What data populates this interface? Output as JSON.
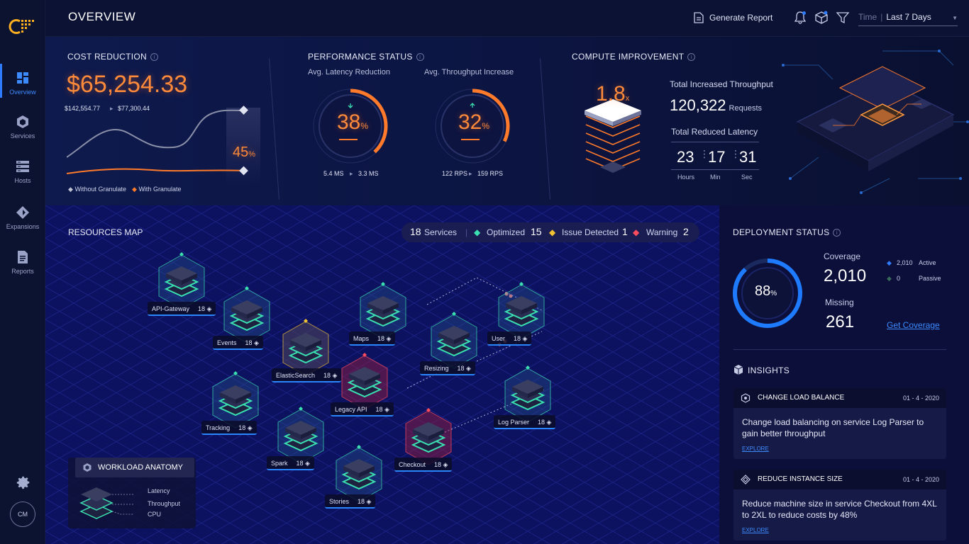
{
  "sidebar": {
    "items": [
      {
        "label": "Overview",
        "icon": "dashboard-icon"
      },
      {
        "label": "Services",
        "icon": "hexagon-icon"
      },
      {
        "label": "Hosts",
        "icon": "server-icon"
      },
      {
        "label": "Expansions",
        "icon": "diamond-icon"
      },
      {
        "label": "Reports",
        "icon": "document-icon"
      }
    ],
    "avatar": "CM"
  },
  "header": {
    "title": "OVERVIEW",
    "report_label": "Generate Report",
    "time_label": "Time",
    "time_value": "Last 7 Days"
  },
  "cost": {
    "title": "COST REDUCTION",
    "value": "$65,254.33",
    "before": "$142,554.77",
    "after": "$77,300.44",
    "percent": "45",
    "percent_unit": "%",
    "legend_without": "Without Granulate",
    "legend_with": "With Granulate"
  },
  "performance": {
    "title": "PERFORMANCE STATUS",
    "latency": {
      "label": "Avg. Latency Reduction",
      "value": "38",
      "unit": "%",
      "from": "5.4 MS",
      "to": "3.3 MS",
      "fraction": 0.38
    },
    "throughput": {
      "label": "Avg. Throughput Increase",
      "value": "32",
      "unit": "%",
      "from": "122 RPS",
      "to": "159 RPS",
      "fraction": 0.32
    }
  },
  "compute": {
    "title": "COMPUTE IMPROVEMENT",
    "multiplier": "1.8",
    "multiplier_unit": "x",
    "throughput_title": "Total Increased Throughput",
    "throughput_value": "120,322",
    "throughput_unit": "Requests",
    "latency_title": "Total Reduced Latency",
    "hours": "23",
    "minutes": "17",
    "seconds": "31",
    "hours_label": "Hours",
    "minutes_label": "Min",
    "seconds_label": "Sec"
  },
  "resources": {
    "title": "RESOURCES MAP",
    "services_count": "18",
    "services_label": "Services",
    "optimized_label": "Optimized",
    "optimized_count": "15",
    "issue_label": "Issue Detected",
    "issue_count": "1",
    "warning_label": "Warning",
    "warning_count": "2",
    "nodes": [
      {
        "name": "API-Gateway",
        "count": "18",
        "status": "optimized"
      },
      {
        "name": "Events",
        "count": "18",
        "status": "optimized"
      },
      {
        "name": "ElasticSearch",
        "count": "18",
        "status": "issue"
      },
      {
        "name": "Maps",
        "count": "18",
        "status": "optimized"
      },
      {
        "name": "Resizing",
        "count": "18",
        "status": "optimized"
      },
      {
        "name": "User",
        "count": "18",
        "status": "optimized"
      },
      {
        "name": "Legacy API",
        "count": "18",
        "status": "warning"
      },
      {
        "name": "Tracking",
        "count": "18",
        "status": "optimized"
      },
      {
        "name": "Log Parser",
        "count": "18",
        "status": "optimized"
      },
      {
        "name": "Spark",
        "count": "18",
        "status": "optimized"
      },
      {
        "name": "Checkout",
        "count": "18",
        "status": "warning"
      },
      {
        "name": "Stories",
        "count": "18",
        "status": "optimized"
      }
    ],
    "workload": {
      "title": "WORKLOAD ANATOMY",
      "latency": "Latency",
      "throughput": "Throughput",
      "cpu": "CPU"
    }
  },
  "deployment": {
    "title": "DEPLOYMENT STATUS",
    "percent": "88",
    "percent_unit": "%",
    "fraction": 0.88,
    "coverage_label": "Coverage",
    "coverage_value": "2,010",
    "missing_label": "Missing",
    "missing_value": "261",
    "active_count": "2,010",
    "active_label": "Active",
    "passive_count": "0",
    "passive_label": "Passive",
    "link": "Get Coverage"
  },
  "insights": {
    "title": "INSIGHTS",
    "cards": [
      {
        "title": "CHANGE LOAD BALANCE",
        "date": "01 - 4 - 2020",
        "body": "Change load balancing on service Log Parser to gain better throughput",
        "link": "EXPLORE"
      },
      {
        "title": "REDUCE INSTANCE SIZE",
        "date": "01 - 4 - 2020",
        "body": "Reduce machine size in service Checkout from 4XL to 2XL to reduce costs by 48%",
        "link": "EXPLORE"
      }
    ]
  },
  "colors": {
    "accent": "#ff8a3a",
    "blue": "#2f7bff",
    "optimized": "#3be0b0",
    "issue": "#f1c232",
    "warning": "#ff4d5e"
  }
}
